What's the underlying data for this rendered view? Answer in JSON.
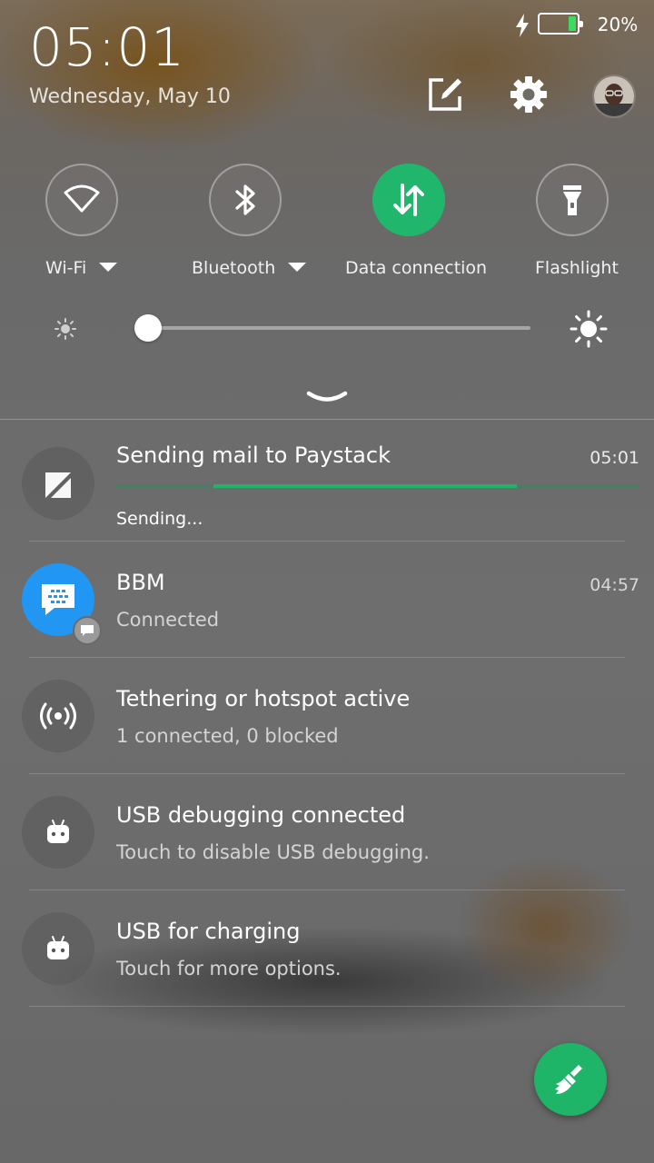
{
  "status_bar": {
    "battery_percent_label": "20%",
    "battery_level": 0.2,
    "charging": true
  },
  "header": {
    "time": "05:01",
    "date": "Wednesday, May 10"
  },
  "header_icons": [
    "edit-icon",
    "settings-gear-icon",
    "avatar"
  ],
  "quick_toggles": [
    {
      "label": "Wi-Fi",
      "icon": "wifi-icon",
      "active": false,
      "has_dropdown": true
    },
    {
      "label": "Bluetooth",
      "icon": "bluetooth-icon",
      "active": false,
      "has_dropdown": true
    },
    {
      "label": "Data connection",
      "icon": "data-arrows-icon",
      "active": true,
      "has_dropdown": false
    },
    {
      "label": "Flashlight",
      "icon": "flashlight-icon",
      "active": false,
      "has_dropdown": false
    }
  ],
  "brightness": {
    "level": 0.03
  },
  "notifications": [
    {
      "app": "mail",
      "title": "Sending mail to Paystack",
      "time": "05:01",
      "subtitle": "Sending...",
      "progress_start": 0.185,
      "progress_end": 0.765
    },
    {
      "app": "bbm",
      "title": "BBM",
      "time": "04:57",
      "subtitle": "Connected"
    },
    {
      "app": "hotspot",
      "title": "Tethering or hotspot active",
      "subtitle": "1 connected, 0 blocked"
    },
    {
      "app": "android",
      "title": "USB debugging connected",
      "subtitle": "Touch to disable USB debugging."
    },
    {
      "app": "android",
      "title": "USB for charging",
      "subtitle": "Touch for more options."
    }
  ],
  "colors": {
    "accent_green": "#1fb568",
    "bbm_blue": "#2196f3",
    "battery_green": "#3ddc60"
  }
}
